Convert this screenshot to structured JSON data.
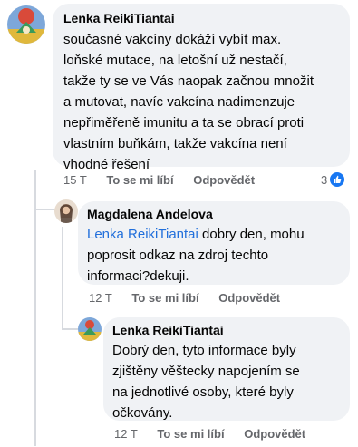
{
  "comments": [
    {
      "author": "Lenka ReikiTiantai",
      "text_lines": [
        "současné vakcíny dokáží vybít max.",
        "loňské mutace, na letošní už nestačí,",
        "takže ty se ve Vás naopak začnou množit",
        "a mutovat, navíc vakcína nadimenzuje",
        "nepřiměřeně imunitu a ta se obrací proti",
        "vlastním buňkám, takže vakcína není",
        "vhodné řešení"
      ],
      "time": "15 T",
      "like": "To se mi líbí",
      "reply": "Odpovědět",
      "reaction_count": "3"
    },
    {
      "author": "Magdalena Andelova",
      "mention": "Lenka ReikiTiantai",
      "text_first_rest": " dobry den, mohu",
      "text_lines": [
        "poprosit odkaz na zdroj techto",
        "informaci?dekuji."
      ],
      "time": "12 T",
      "like": "To se mi líbí",
      "reply": "Odpovědět"
    },
    {
      "author": "Lenka ReikiTiantai",
      "text_lines": [
        "Dobrý den, tyto informace byly",
        "zjištěny věštecky napojením se",
        "na jednotlivé osoby, které byly",
        "očkovány."
      ],
      "time": "12 T",
      "like": "To se mi líbí",
      "reply": "Odpovědět"
    }
  ],
  "colors": {
    "bubble": "#f0f2f5",
    "mention": "#216fdb",
    "meta": "#65676b",
    "like_badge": "#1877f2"
  }
}
